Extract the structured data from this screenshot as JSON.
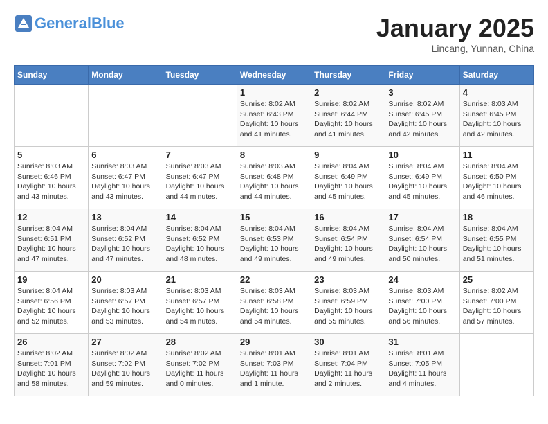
{
  "header": {
    "logo_line1": "General",
    "logo_line2": "Blue",
    "month": "January 2025",
    "location": "Lincang, Yunnan, China"
  },
  "days_of_week": [
    "Sunday",
    "Monday",
    "Tuesday",
    "Wednesday",
    "Thursday",
    "Friday",
    "Saturday"
  ],
  "weeks": [
    [
      {
        "day": "",
        "info": ""
      },
      {
        "day": "",
        "info": ""
      },
      {
        "day": "",
        "info": ""
      },
      {
        "day": "1",
        "info": "Sunrise: 8:02 AM\nSunset: 6:43 PM\nDaylight: 10 hours\nand 41 minutes."
      },
      {
        "day": "2",
        "info": "Sunrise: 8:02 AM\nSunset: 6:44 PM\nDaylight: 10 hours\nand 41 minutes."
      },
      {
        "day": "3",
        "info": "Sunrise: 8:02 AM\nSunset: 6:45 PM\nDaylight: 10 hours\nand 42 minutes."
      },
      {
        "day": "4",
        "info": "Sunrise: 8:03 AM\nSunset: 6:45 PM\nDaylight: 10 hours\nand 42 minutes."
      }
    ],
    [
      {
        "day": "5",
        "info": "Sunrise: 8:03 AM\nSunset: 6:46 PM\nDaylight: 10 hours\nand 43 minutes."
      },
      {
        "day": "6",
        "info": "Sunrise: 8:03 AM\nSunset: 6:47 PM\nDaylight: 10 hours\nand 43 minutes."
      },
      {
        "day": "7",
        "info": "Sunrise: 8:03 AM\nSunset: 6:47 PM\nDaylight: 10 hours\nand 44 minutes."
      },
      {
        "day": "8",
        "info": "Sunrise: 8:03 AM\nSunset: 6:48 PM\nDaylight: 10 hours\nand 44 minutes."
      },
      {
        "day": "9",
        "info": "Sunrise: 8:04 AM\nSunset: 6:49 PM\nDaylight: 10 hours\nand 45 minutes."
      },
      {
        "day": "10",
        "info": "Sunrise: 8:04 AM\nSunset: 6:49 PM\nDaylight: 10 hours\nand 45 minutes."
      },
      {
        "day": "11",
        "info": "Sunrise: 8:04 AM\nSunset: 6:50 PM\nDaylight: 10 hours\nand 46 minutes."
      }
    ],
    [
      {
        "day": "12",
        "info": "Sunrise: 8:04 AM\nSunset: 6:51 PM\nDaylight: 10 hours\nand 47 minutes."
      },
      {
        "day": "13",
        "info": "Sunrise: 8:04 AM\nSunset: 6:52 PM\nDaylight: 10 hours\nand 47 minutes."
      },
      {
        "day": "14",
        "info": "Sunrise: 8:04 AM\nSunset: 6:52 PM\nDaylight: 10 hours\nand 48 minutes."
      },
      {
        "day": "15",
        "info": "Sunrise: 8:04 AM\nSunset: 6:53 PM\nDaylight: 10 hours\nand 49 minutes."
      },
      {
        "day": "16",
        "info": "Sunrise: 8:04 AM\nSunset: 6:54 PM\nDaylight: 10 hours\nand 49 minutes."
      },
      {
        "day": "17",
        "info": "Sunrise: 8:04 AM\nSunset: 6:54 PM\nDaylight: 10 hours\nand 50 minutes."
      },
      {
        "day": "18",
        "info": "Sunrise: 8:04 AM\nSunset: 6:55 PM\nDaylight: 10 hours\nand 51 minutes."
      }
    ],
    [
      {
        "day": "19",
        "info": "Sunrise: 8:04 AM\nSunset: 6:56 PM\nDaylight: 10 hours\nand 52 minutes."
      },
      {
        "day": "20",
        "info": "Sunrise: 8:03 AM\nSunset: 6:57 PM\nDaylight: 10 hours\nand 53 minutes."
      },
      {
        "day": "21",
        "info": "Sunrise: 8:03 AM\nSunset: 6:57 PM\nDaylight: 10 hours\nand 54 minutes."
      },
      {
        "day": "22",
        "info": "Sunrise: 8:03 AM\nSunset: 6:58 PM\nDaylight: 10 hours\nand 54 minutes."
      },
      {
        "day": "23",
        "info": "Sunrise: 8:03 AM\nSunset: 6:59 PM\nDaylight: 10 hours\nand 55 minutes."
      },
      {
        "day": "24",
        "info": "Sunrise: 8:03 AM\nSunset: 7:00 PM\nDaylight: 10 hours\nand 56 minutes."
      },
      {
        "day": "25",
        "info": "Sunrise: 8:02 AM\nSunset: 7:00 PM\nDaylight: 10 hours\nand 57 minutes."
      }
    ],
    [
      {
        "day": "26",
        "info": "Sunrise: 8:02 AM\nSunset: 7:01 PM\nDaylight: 10 hours\nand 58 minutes."
      },
      {
        "day": "27",
        "info": "Sunrise: 8:02 AM\nSunset: 7:02 PM\nDaylight: 10 hours\nand 59 minutes."
      },
      {
        "day": "28",
        "info": "Sunrise: 8:02 AM\nSunset: 7:02 PM\nDaylight: 11 hours\nand 0 minutes."
      },
      {
        "day": "29",
        "info": "Sunrise: 8:01 AM\nSunset: 7:03 PM\nDaylight: 11 hours\nand 1 minute."
      },
      {
        "day": "30",
        "info": "Sunrise: 8:01 AM\nSunset: 7:04 PM\nDaylight: 11 hours\nand 2 minutes."
      },
      {
        "day": "31",
        "info": "Sunrise: 8:01 AM\nSunset: 7:05 PM\nDaylight: 11 hours\nand 4 minutes."
      },
      {
        "day": "",
        "info": ""
      }
    ]
  ]
}
